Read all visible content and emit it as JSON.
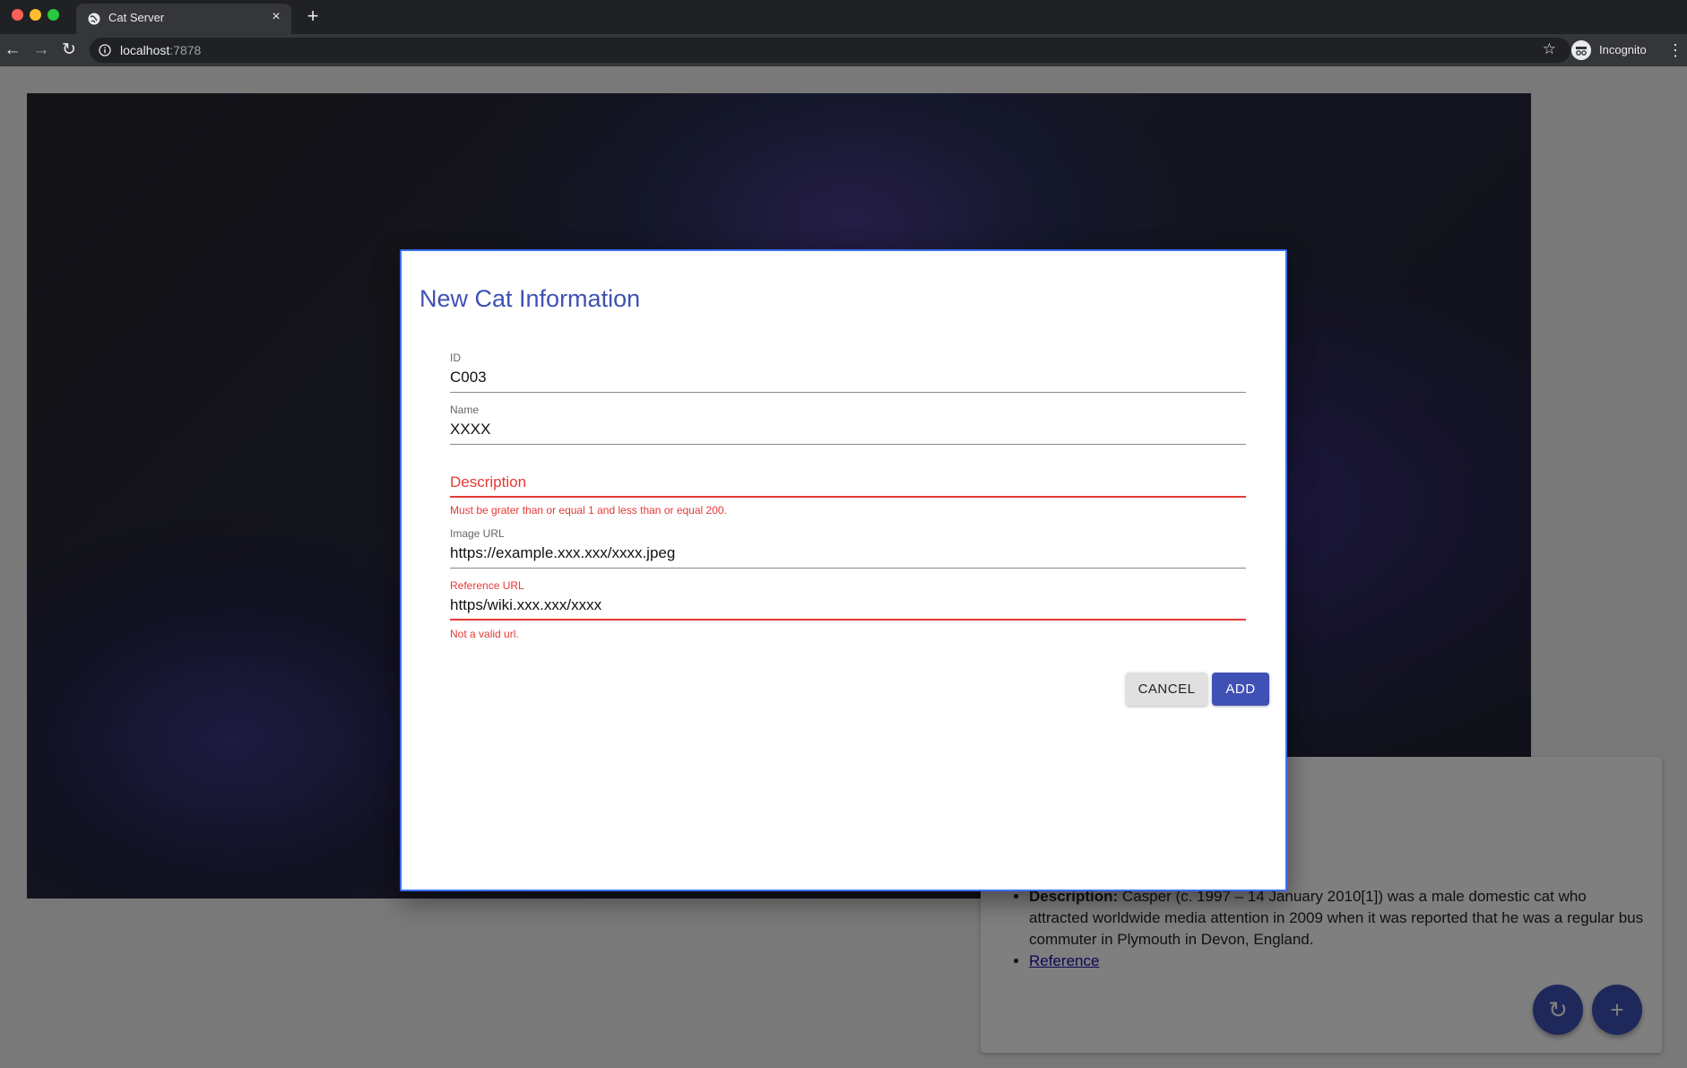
{
  "browser": {
    "tab_title": "Cat Server",
    "url_host": "localhost",
    "url_port": ":7878",
    "profile_label": "Incognito",
    "close_tab_symbol": "×",
    "new_tab_symbol": "+",
    "back_symbol": "←",
    "forward_symbol": "→",
    "reload_symbol": "↻",
    "star_symbol": "☆",
    "menu_symbol": "⋮"
  },
  "card": {
    "description_label": "Description:",
    "description_text": "Casper (c. 1997 – 14 January 2010[1]) was a male domestic cat who attracted worldwide media attention in 2009 when it was reported that he was a regular bus commuter in Plymouth in Devon, England.",
    "reference_label": "Reference"
  },
  "fabs": {
    "refresh_symbol": "↻",
    "add_symbol": "+"
  },
  "dialog": {
    "title": "New Cat Information",
    "fields": {
      "id": {
        "label": "ID",
        "value": "C003"
      },
      "name": {
        "label": "Name",
        "value": "XXXX"
      },
      "description": {
        "label": "Description",
        "value": "",
        "error": "Must be grater than or equal 1 and less than or equal 200."
      },
      "image_url": {
        "label": "Image URL",
        "value": "https://example.xxx.xxx/xxxx.jpeg"
      },
      "reference_url": {
        "label": "Reference URL",
        "value": "https/wiki.xxx.xxx/xxxx",
        "error": "Not a valid url."
      }
    },
    "cancel_label": "CANCEL",
    "add_label": "ADD"
  },
  "colors": {
    "primary": "#3f51b5",
    "error": "#e53935",
    "dialog_border": "#3b6ef0"
  }
}
